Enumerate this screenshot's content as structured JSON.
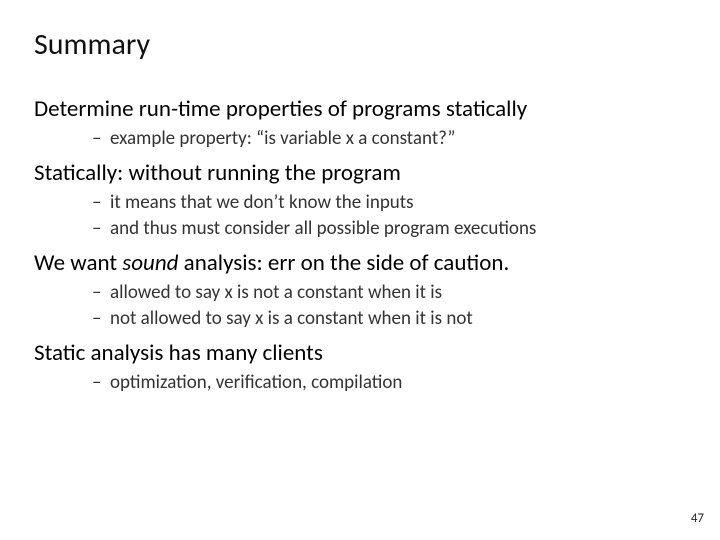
{
  "title": "Summary",
  "points": [
    {
      "text": "Determine run-time properties of programs statically",
      "subs": [
        "example property: “is variable x a constant?”"
      ]
    },
    {
      "text": "Statically: without running the program",
      "subs": [
        "it means that we don’t know the inputs",
        "and thus must consider all possible program executions"
      ]
    },
    {
      "text_pre": "We want ",
      "text_italic": "sound",
      "text_post": " analysis: err on the side of caution.",
      "subs": [
        "allowed to say x is not a constant when it is",
        "not allowed to say x is a constant when it is not"
      ]
    },
    {
      "text": "Static analysis has many clients",
      "subs": [
        "optimization, verification, compilation"
      ]
    }
  ],
  "page_number": "47"
}
